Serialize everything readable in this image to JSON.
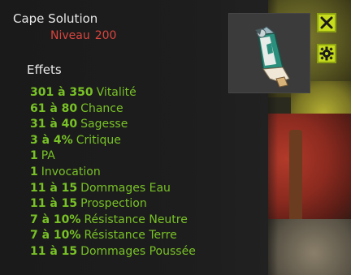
{
  "item": {
    "name": "Cape Solution",
    "level_label": "Niveau",
    "level_value": "200"
  },
  "effects_title": "Effets",
  "effects": [
    {
      "value": "301 à 350",
      "stat": "Vitalité"
    },
    {
      "value": "61 à 80",
      "stat": "Chance"
    },
    {
      "value": "31 à 40",
      "stat": "Sagesse"
    },
    {
      "value": "3 à 4%",
      "stat": "Critique"
    },
    {
      "value": "1",
      "stat": "PA"
    },
    {
      "value": "1",
      "stat": "Invocation"
    },
    {
      "value": "11 à 15",
      "stat": "Dommages Eau"
    },
    {
      "value": "11 à 15",
      "stat": "Prospection"
    },
    {
      "value": "7 à 10%",
      "stat": "Résistance Neutre"
    },
    {
      "value": "7 à 10%",
      "stat": "Résistance Terre"
    },
    {
      "value": "11 à 15",
      "stat": "Dommages Poussée"
    }
  ],
  "icons": {
    "close": "close-icon",
    "settings": "gear-icon"
  },
  "colors": {
    "panel_bg": "#1b1b1b",
    "effect_green": "#78c226",
    "level_red": "#d9453e",
    "button_yellow": "#c7dc1c"
  }
}
